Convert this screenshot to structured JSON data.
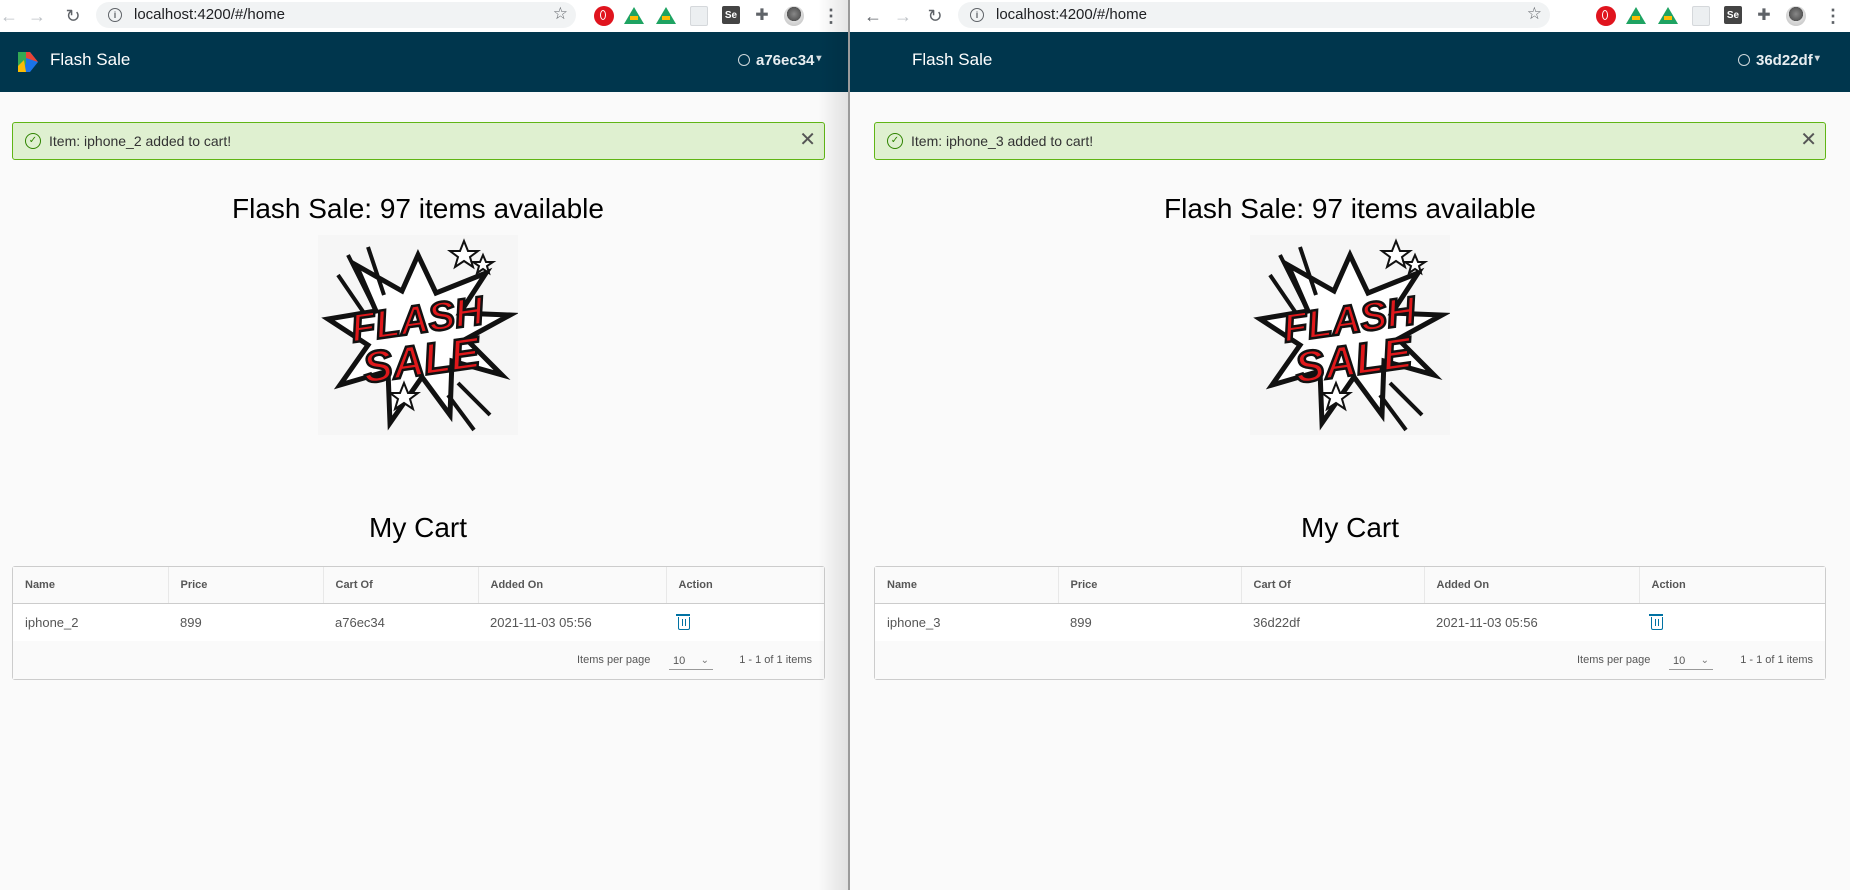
{
  "windows": [
    {
      "browser": {
        "url": "localhost:4200/#/home"
      },
      "app": {
        "brand": "Flash Sale",
        "user": "a76ec34"
      },
      "alert": {
        "message": "Item: iphone_2 added to cart!"
      },
      "sale": {
        "heading": "Flash Sale: 97 items available",
        "image_text": [
          "FLASH",
          "SALE"
        ]
      },
      "cart": {
        "heading": "My Cart",
        "columns": [
          "Name",
          "Price",
          "Cart Of",
          "Added On",
          "Action"
        ],
        "rows": [
          {
            "name": "iphone_2",
            "price": "899",
            "cart_of": "a76ec34",
            "added_on": "2021-11-03 05:56"
          }
        ],
        "footer": {
          "items_per_page_label": "Items per page",
          "items_per_page": "10",
          "range": "1 - 1 of 1 items"
        }
      }
    },
    {
      "browser": {
        "url": "localhost:4200/#/home"
      },
      "app": {
        "brand": "Flash Sale",
        "user": "36d22df"
      },
      "alert": {
        "message": "Item: iphone_3 added to cart!"
      },
      "sale": {
        "heading": "Flash Sale: 97 items available",
        "image_text": [
          "FLASH",
          "SALE"
        ]
      },
      "cart": {
        "heading": "My Cart",
        "columns": [
          "Name",
          "Price",
          "Cart Of",
          "Added On",
          "Action"
        ],
        "rows": [
          {
            "name": "iphone_3",
            "price": "899",
            "cart_of": "36d22df",
            "added_on": "2021-11-03 05:56"
          }
        ],
        "footer": {
          "items_per_page_label": "Items per page",
          "items_per_page": "10",
          "range": "1 - 1 of 1 items"
        }
      }
    }
  ],
  "icons": {
    "browser": [
      "back-arrow-icon",
      "forward-arrow-icon",
      "reload-icon",
      "site-info-icon",
      "bookmark-star-icon",
      "opera-extension-icon",
      "google-drive-icon",
      "blank-extension-icon",
      "selenium-icon",
      "extensions-puzzle-icon",
      "profile-avatar-icon",
      "chrome-menu-icon"
    ],
    "app": [
      "app-logo-icon",
      "user-icon",
      "chevron-down-icon",
      "success-check-icon",
      "close-icon",
      "trash-icon"
    ]
  },
  "colors": {
    "header_bg": "#00364d",
    "alert_bg": "#dff0d0",
    "alert_border": "#60b515",
    "action_icon": "#0072a3"
  }
}
